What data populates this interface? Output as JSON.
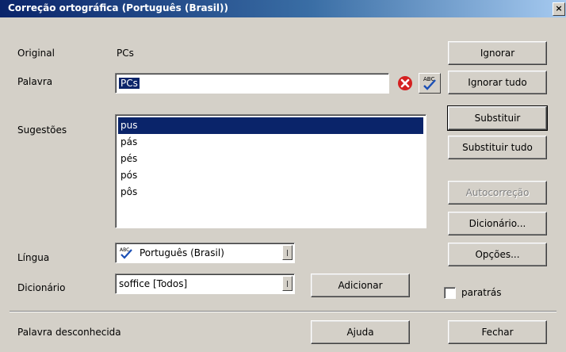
{
  "title": "Correção ortográfica (Português (Brasil))",
  "close_glyph": "×",
  "labels": {
    "original": "Original",
    "palavra": "Palavra",
    "sugestoes": "Sugestões",
    "lingua": "Língua",
    "dicionario": "Dicionário"
  },
  "original_value": "PCs",
  "palavra_value": "PCs",
  "suggestions": [
    "pus",
    "pás",
    "pés",
    "pós",
    "pôs"
  ],
  "selected_suggestion": "pus",
  "lingua_value": "Português (Brasil)",
  "dicionario_value": "soffice [Todos]",
  "buttons": {
    "ignorar": "Ignorar",
    "ignorar_tudo": "Ignorar tudo",
    "substituir": "Substituir",
    "substituir_tudo": "Substituir tudo",
    "autocorrecao": "Autocorreção",
    "dicionario": "Dicionário...",
    "opcoes": "Opções...",
    "adicionar": "Adicionar",
    "ajuda": "Ajuda",
    "fechar": "Fechar"
  },
  "checkbox_label": "paratrás",
  "status": "Palavra desconhecida",
  "colors": {
    "title_start": "#0a246a",
    "title_end": "#a6caf0",
    "selection": "#0a246a",
    "error": "#d42020"
  },
  "icons": [
    "error-icon",
    "spellcheck-icon",
    "language-spellcheck-icon"
  ]
}
